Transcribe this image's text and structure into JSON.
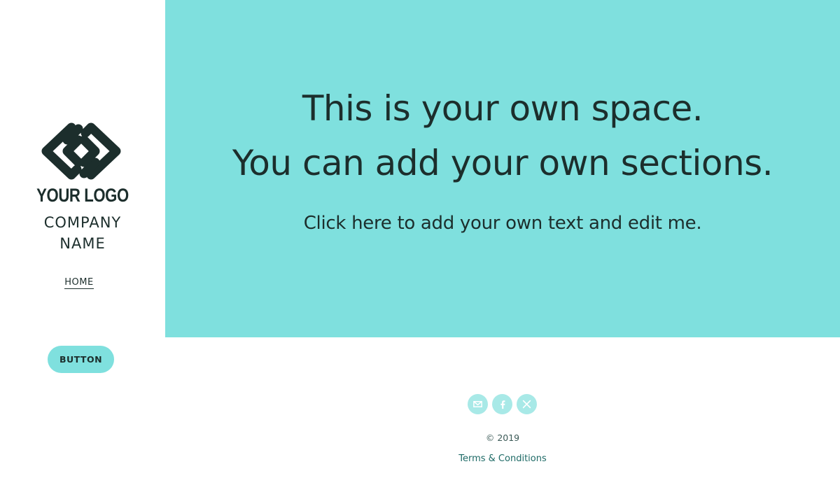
{
  "sidebar": {
    "logo_text": "YOUR LOGO",
    "company_line1": "COMPANY",
    "company_line2": "NAME",
    "nav": [
      {
        "label": "HOME"
      }
    ],
    "button_label": "BUTTON"
  },
  "hero": {
    "line1": "This is your own space.",
    "line2": "You can add your own sections.",
    "sub": "Click here to add your own text and edit me."
  },
  "footer": {
    "social_icons": [
      "email-icon",
      "facebook-icon",
      "x-icon"
    ],
    "copyright": "© 2019",
    "terms": "Terms & Conditions"
  },
  "colors": {
    "accent": "#7fe0de",
    "text": "#1c2e2c",
    "social": "#a8e9e7"
  }
}
